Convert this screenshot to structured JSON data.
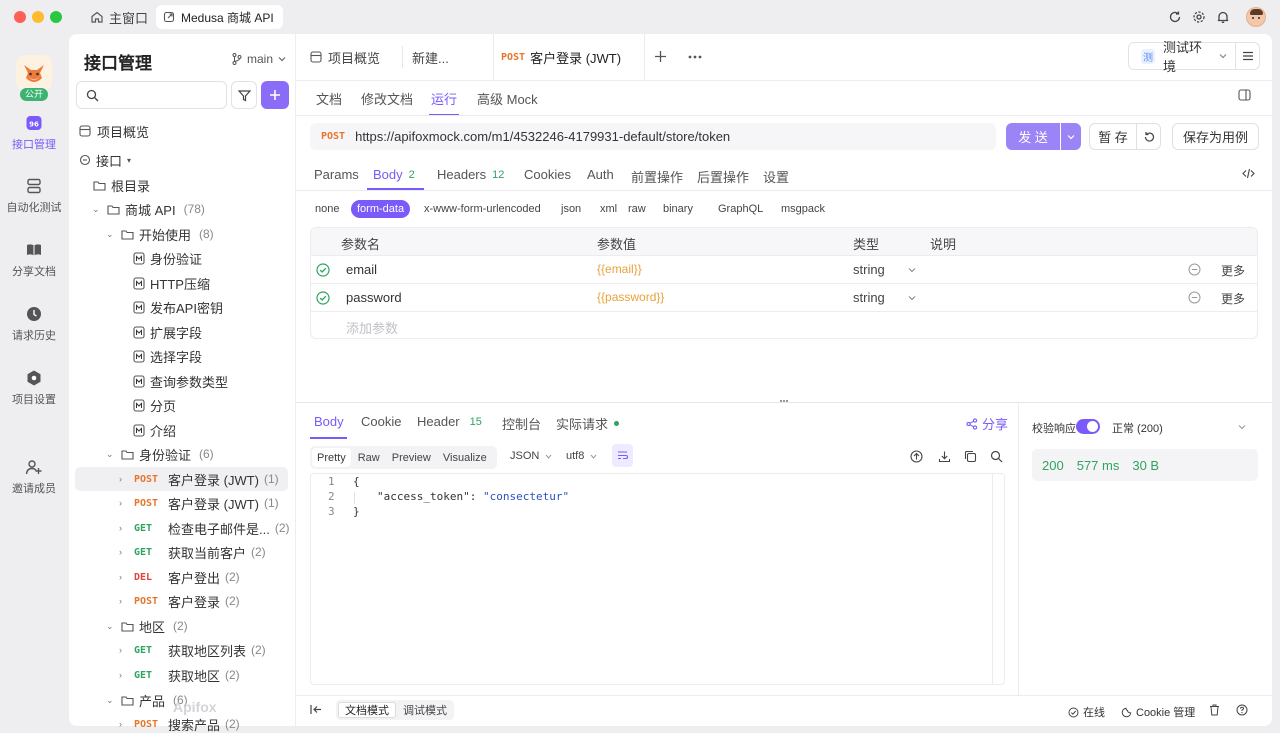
{
  "window": {
    "home_tab": "主窗口",
    "active_tab": "Medusa 商城 API"
  },
  "rail": {
    "badge": "公开",
    "items": [
      {
        "label": "接口管理",
        "icon": "api-icon"
      },
      {
        "label": "自动化测试",
        "icon": "automation-icon"
      },
      {
        "label": "分享文档",
        "icon": "book-icon"
      },
      {
        "label": "请求历史",
        "icon": "history-icon"
      },
      {
        "label": "项目设置",
        "icon": "settings-icon"
      },
      {
        "label": "邀请成员",
        "icon": "invite-icon"
      }
    ]
  },
  "sidebar": {
    "title": "接口管理",
    "branch": "main",
    "tree": [
      {
        "text": "项目概览",
        "type": "overview"
      },
      {
        "text": "接口",
        "type": "root"
      },
      {
        "text": "根目录",
        "type": "folder-root"
      },
      {
        "text": "商城 API",
        "count": "(78)",
        "type": "folder"
      },
      {
        "text": "开始使用",
        "count": "(8)",
        "type": "folder"
      },
      {
        "text": "身份验证",
        "type": "doc"
      },
      {
        "text": "HTTP压缩",
        "type": "doc"
      },
      {
        "text": "发布API密钥",
        "type": "doc"
      },
      {
        "text": "扩展字段",
        "type": "doc"
      },
      {
        "text": "选择字段",
        "type": "doc"
      },
      {
        "text": "查询参数类型",
        "type": "doc"
      },
      {
        "text": "分页",
        "type": "doc"
      },
      {
        "text": "介绍",
        "type": "doc"
      },
      {
        "text": "身份验证",
        "count": "(6)",
        "type": "folder"
      },
      {
        "method": "POST",
        "text": "客户登录 (JWT)",
        "count": "(1)",
        "type": "api"
      },
      {
        "method": "POST",
        "text": "客户登录 (JWT)",
        "count": "(1)",
        "type": "api"
      },
      {
        "method": "GET",
        "text": "检查电子邮件是...",
        "count": "(2)",
        "type": "api"
      },
      {
        "method": "GET",
        "text": "获取当前客户",
        "count": "(2)",
        "type": "api"
      },
      {
        "method": "DEL",
        "text": "客户登出",
        "count": "(2)",
        "type": "api"
      },
      {
        "method": "POST",
        "text": "客户登录",
        "count": "(2)",
        "type": "api"
      },
      {
        "text": "地区",
        "count": "(2)",
        "type": "folder"
      },
      {
        "method": "GET",
        "text": "获取地区列表",
        "count": "(2)",
        "type": "api"
      },
      {
        "method": "GET",
        "text": "获取地区",
        "count": "(2)",
        "type": "api"
      },
      {
        "text": "产品",
        "count": "(6)",
        "type": "folder"
      },
      {
        "method": "POST",
        "text": "搜索产品",
        "count": "(2)",
        "type": "api"
      }
    ],
    "watermark": "Apifox"
  },
  "tabs": {
    "items": [
      "项目概览",
      "新建...",
      "客户登录 (JWT)"
    ],
    "active_method": "POST",
    "env": "测试环境",
    "env_badge": "测"
  },
  "subtabs": [
    "文档",
    "修改文档",
    "运行",
    "高级 Mock"
  ],
  "request": {
    "method": "POST",
    "url": "https://apifoxmock.com/m1/4532246-4179931-default/store/token",
    "send": "发 送",
    "save": "暂 存",
    "save_case": "保存为用例"
  },
  "param_tabs": [
    {
      "label": "Params"
    },
    {
      "label": "Body",
      "count": "2"
    },
    {
      "label": "Headers",
      "count": "12"
    },
    {
      "label": "Cookies"
    },
    {
      "label": "Auth"
    },
    {
      "label": "前置操作"
    },
    {
      "label": "后置操作"
    },
    {
      "label": "设置"
    }
  ],
  "body_types": [
    "none",
    "form-data",
    "x-www-form-urlencoded",
    "json",
    "xml",
    "raw",
    "binary",
    "GraphQL",
    "msgpack"
  ],
  "params_table": {
    "headers": [
      "参数名",
      "参数值",
      "类型",
      "说明"
    ],
    "rows": [
      {
        "name": "email",
        "value": "{{email}}",
        "type": "string",
        "more": "更多"
      },
      {
        "name": "password",
        "value": "{{password}}",
        "type": "string",
        "more": "更多"
      }
    ],
    "add_placeholder": "添加参数"
  },
  "response": {
    "tabs": [
      {
        "label": "Body"
      },
      {
        "label": "Cookie"
      },
      {
        "label": "Header",
        "count": "15"
      },
      {
        "label": "控制台"
      },
      {
        "label": "实际请求"
      }
    ],
    "share": "分享",
    "views": [
      "Pretty",
      "Raw",
      "Preview",
      "Visualize"
    ],
    "format": "JSON",
    "encoding": "utf8",
    "code_lines": [
      {
        "n": "1",
        "text": "{"
      },
      {
        "n": "2",
        "key": "\"access_token\"",
        "value": "\"consectetur\""
      },
      {
        "n": "3",
        "text": "}"
      }
    ],
    "validate_label": "校验响应",
    "validate_status": "正常 (200)",
    "status_code": "200",
    "time": "577 ms",
    "size": "30 B"
  },
  "footer": {
    "doc_mode": "文档模式",
    "debug_mode": "调试模式",
    "online": "在线",
    "cookie_mgr": "Cookie 管理"
  },
  "colors": {
    "accent": "#7a5af8",
    "post": "#e8752a",
    "get": "#2fa360",
    "del": "#e0433d",
    "value_orange": "#e8a23a",
    "success_green": "#2fa360"
  }
}
